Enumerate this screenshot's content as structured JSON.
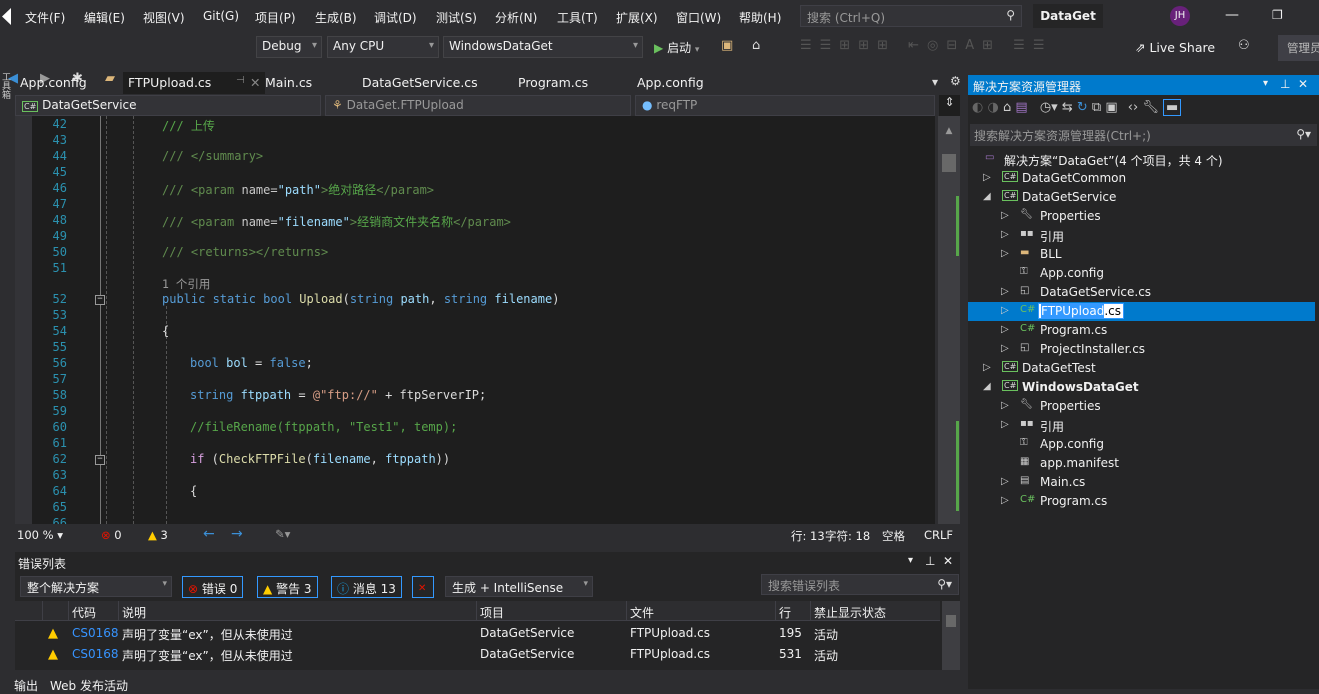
{
  "menu": [
    "文件(F)",
    "编辑(E)",
    "视图(V)",
    "Git(G)",
    "项目(P)",
    "生成(B)",
    "调试(D)",
    "测试(S)",
    "分析(N)",
    "工具(T)",
    "扩展(X)",
    "窗口(W)",
    "帮助(H)"
  ],
  "search_placeholder": "搜索 (Ctrl+Q)",
  "window_title": "DataGet",
  "avatar_initials": "JH",
  "toolbar": {
    "config": "Debug",
    "platform": "Any CPU",
    "startup": "WindowsDataGet",
    "start": "启动",
    "live_share": "Live Share",
    "admin": "管理员"
  },
  "doc_tabs": [
    "App.config",
    "FTPUpload.cs",
    "Main.cs",
    "DataGetService.cs",
    "Program.cs",
    "App.config"
  ],
  "nav": {
    "project": "DataGetService",
    "class": "DataGet.FTPUpload",
    "member": "reqFTP"
  },
  "code_lines": [
    {
      "n": "42",
      "i": 0,
      "t": [
        [
          "c",
          "/// 上传"
        ]
      ]
    },
    {
      "n": "43",
      "i": 0,
      "t": []
    },
    {
      "n": "44",
      "i": 0,
      "t": [
        [
          "x",
          "/// </summary>"
        ]
      ]
    },
    {
      "n": "45",
      "i": 0,
      "t": []
    },
    {
      "n": "46",
      "i": 0,
      "t": [
        [
          "x",
          "/// <param "
        ],
        [
          "w",
          "name="
        ],
        [
          "p",
          "\"path\""
        ],
        [
          "x",
          ">"
        ],
        [
          "c",
          "绝对路径"
        ],
        [
          "x",
          "</param>"
        ]
      ]
    },
    {
      "n": "47",
      "i": 0,
      "t": []
    },
    {
      "n": "48",
      "i": 0,
      "t": [
        [
          "x",
          "/// <param "
        ],
        [
          "w",
          "name="
        ],
        [
          "p",
          "\"filename\""
        ],
        [
          "x",
          ">"
        ],
        [
          "c",
          "经销商文件夹名称"
        ],
        [
          "x",
          "</param>"
        ]
      ]
    },
    {
      "n": "49",
      "i": 0,
      "t": []
    },
    {
      "n": "50",
      "i": 0,
      "t": [
        [
          "x",
          "/// <returns></returns>"
        ]
      ]
    },
    {
      "n": "51",
      "i": 0,
      "t": []
    },
    {
      "n": "",
      "i": 0,
      "lens": true,
      "t": [
        [
          "g",
          "1 个引用"
        ]
      ]
    },
    {
      "n": "52",
      "i": 0,
      "fold": true,
      "t": [
        [
          "k",
          "public static bool "
        ],
        [
          "m",
          "Upload"
        ],
        [
          "t",
          "("
        ],
        [
          "k",
          "string "
        ],
        [
          "p",
          "path"
        ],
        [
          "t",
          ", "
        ],
        [
          "k",
          "string "
        ],
        [
          "p",
          "filename"
        ],
        [
          "t",
          ")"
        ]
      ]
    },
    {
      "n": "53",
      "i": 0,
      "t": []
    },
    {
      "n": "54",
      "i": 0,
      "t": [
        [
          "t",
          "{"
        ]
      ]
    },
    {
      "n": "55",
      "i": 0,
      "t": []
    },
    {
      "n": "56",
      "i": 1,
      "t": [
        [
          "k",
          "bool "
        ],
        [
          "p",
          "bol"
        ],
        [
          "t",
          " = "
        ],
        [
          "k",
          "false"
        ],
        [
          "t",
          ";"
        ]
      ]
    },
    {
      "n": "57",
      "i": 1,
      "t": []
    },
    {
      "n": "58",
      "i": 1,
      "t": [
        [
          "k",
          "string "
        ],
        [
          "p",
          "ftppath"
        ],
        [
          "t",
          " = "
        ],
        [
          "s",
          "@\"ftp://\""
        ],
        [
          "t",
          " + ftpServerIP;"
        ]
      ]
    },
    {
      "n": "59",
      "i": 1,
      "t": []
    },
    {
      "n": "60",
      "i": 1,
      "t": [
        [
          "c",
          "//fileRename(ftppath, \"Test1\", temp);"
        ]
      ]
    },
    {
      "n": "61",
      "i": 1,
      "t": []
    },
    {
      "n": "62",
      "i": 1,
      "fold": true,
      "t": [
        [
          "f",
          "if"
        ],
        [
          "t",
          " ("
        ],
        [
          "m",
          "CheckFTPFile"
        ],
        [
          "t",
          "("
        ],
        [
          "p",
          "filename"
        ],
        [
          "t",
          ", "
        ],
        [
          "p",
          "ftppath"
        ],
        [
          "t",
          "))"
        ]
      ]
    },
    {
      "n": "63",
      "i": 1,
      "t": []
    },
    {
      "n": "64",
      "i": 1,
      "t": [
        [
          "t",
          "{"
        ]
      ]
    },
    {
      "n": "65",
      "i": 1,
      "t": []
    },
    {
      "n": "66",
      "i": 1,
      "t": []
    }
  ],
  "status": {
    "zoom": "100 %",
    "errors": "0",
    "warnings": "3",
    "line": "行: 13",
    "char": "字符: 18",
    "ws": "空格",
    "eol": "CRLF"
  },
  "error_list": {
    "title": "错误列表",
    "scope": "整个解决方案",
    "errors": "错误 0",
    "warnings": "警告 3",
    "messages": "消息 13",
    "source": "生成 + IntelliSense",
    "search_placeholder": "搜索错误列表",
    "columns": [
      "代码",
      "说明",
      "项目",
      "文件",
      "行",
      "禁止显示状态"
    ],
    "rows": [
      {
        "code": "CS0168",
        "desc": "声明了变量“ex”，但从未使用过",
        "project": "DataGetService",
        "file": "FTPUpload.cs",
        "line": "195",
        "state": "活动"
      },
      {
        "code": "CS0168",
        "desc": "声明了变量“ex”，但从未使用过",
        "project": "DataGetService",
        "file": "FTPUpload.cs",
        "line": "531",
        "state": "活动"
      }
    ]
  },
  "bottom_tabs": [
    "输出",
    "Web 发布活动"
  ],
  "solution_explorer": {
    "title": "解决方案资源管理器",
    "search_placeholder": "搜索解决方案资源管理器(Ctrl+;)",
    "items": [
      {
        "label": "解决方案“DataGet”(4 个项目，共 4 个)",
        "level": 0,
        "icon": "solution-icon",
        "arrow": ""
      },
      {
        "label": "DataGetCommon",
        "level": 1,
        "icon": "csproj-icon",
        "arrow": "collapsed"
      },
      {
        "label": "DataGetService",
        "level": 1,
        "icon": "csproj-icon",
        "arrow": "expanded"
      },
      {
        "label": "Properties",
        "level": 2,
        "icon": "wrench-icon",
        "arrow": "collapsed"
      },
      {
        "label": "引用",
        "level": 2,
        "icon": "references-icon",
        "arrow": "collapsed"
      },
      {
        "label": "BLL",
        "level": 2,
        "icon": "folder-icon",
        "arrow": "collapsed"
      },
      {
        "label": "App.config",
        "level": 2,
        "icon": "config-icon",
        "arrow": ""
      },
      {
        "label": "DataGetService.cs",
        "level": 2,
        "icon": "component-icon",
        "arrow": "collapsed"
      },
      {
        "label": "FTPUpload.cs",
        "level": 2,
        "icon": "csharp-file-icon",
        "arrow": "collapsed",
        "selected": true,
        "rename_selected": "FTPUpload",
        "rename_rest": ".cs"
      },
      {
        "label": "Program.cs",
        "level": 2,
        "icon": "csharp-file-icon",
        "arrow": "collapsed"
      },
      {
        "label": "ProjectInstaller.cs",
        "level": 2,
        "icon": "component-icon",
        "arrow": "collapsed"
      },
      {
        "label": "DataGetTest",
        "level": 1,
        "icon": "csproj-icon",
        "arrow": "collapsed"
      },
      {
        "label": "WindowsDataGet",
        "level": 1,
        "icon": "csproj-icon",
        "arrow": "expanded",
        "bold": true
      },
      {
        "label": "Properties",
        "level": 2,
        "icon": "wrench-icon",
        "arrow": "collapsed"
      },
      {
        "label": "引用",
        "level": 2,
        "icon": "references-icon",
        "arrow": "collapsed"
      },
      {
        "label": "App.config",
        "level": 2,
        "icon": "config-icon",
        "arrow": ""
      },
      {
        "label": "app.manifest",
        "level": 2,
        "icon": "manifest-icon",
        "arrow": ""
      },
      {
        "label": "Main.cs",
        "level": 2,
        "icon": "form-icon",
        "arrow": "collapsed"
      },
      {
        "label": "Program.cs",
        "level": 2,
        "icon": "csharp-file-icon",
        "arrow": "collapsed"
      }
    ]
  },
  "colors": {
    "accent": "#007acc",
    "editor_bg": "#1e1e1e",
    "chrome_bg": "#2d2d30"
  }
}
